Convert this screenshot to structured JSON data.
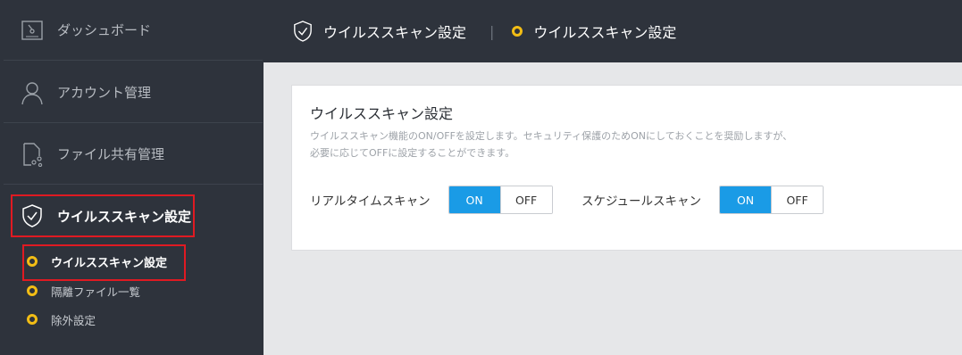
{
  "sidebar": {
    "items": [
      {
        "label": "ダッシュボード",
        "icon": "dashboard-icon"
      },
      {
        "label": "アカウント管理",
        "icon": "user-icon"
      },
      {
        "label": "ファイル共有管理",
        "icon": "file-share-icon"
      },
      {
        "label": "ウイルススキャン設定",
        "icon": "shield-check-icon"
      }
    ],
    "subitems": [
      {
        "label": "ウイルススキャン設定"
      },
      {
        "label": "隔離ファイル一覧"
      },
      {
        "label": "除外設定"
      }
    ]
  },
  "header": {
    "section": "ウイルススキャン設定",
    "separator": "|",
    "page": "ウイルススキャン設定"
  },
  "card": {
    "title": "ウイルススキャン設定",
    "description_line1": "ウイルススキャン機能のON/OFFを設定します。セキュリティ保護のためONにしておくことを奨励しますが、",
    "description_line2": "必要に応じてOFFに設定することができます。",
    "realtime": {
      "label": "リアルタイムスキャン",
      "on": "ON",
      "off": "OFF",
      "state": "ON"
    },
    "schedule": {
      "label": "スケジュールスキャン",
      "on": "ON",
      "off": "OFF",
      "state": "ON"
    }
  },
  "colors": {
    "accent": "#1a9be6",
    "bullet": "#f2bd15",
    "highlight_box": "#e01a22",
    "sidebar_bg": "#2e333c"
  }
}
